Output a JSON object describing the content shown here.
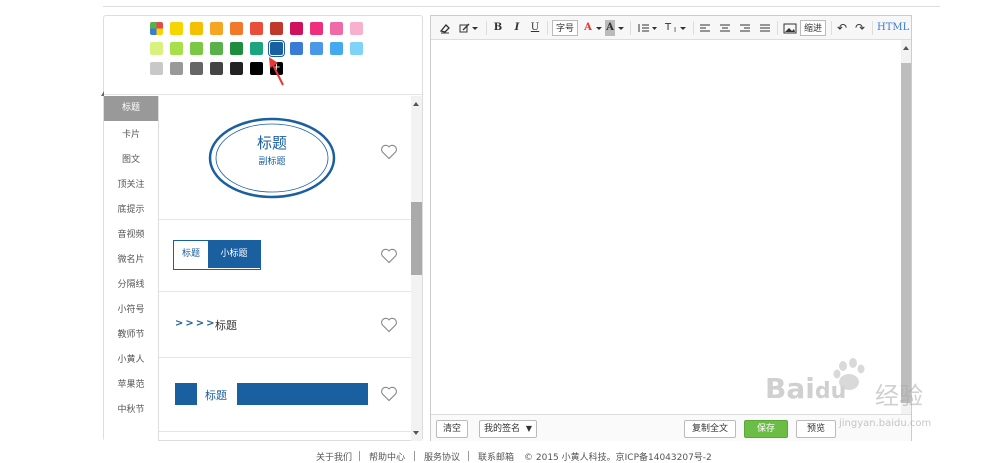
{
  "palette": {
    "row1": [
      "#e5484d",
      "#f7d600",
      "#f5c000",
      "#f5a623",
      "#f07a2a",
      "#e94e3a",
      "#c0392b",
      "#d0105a",
      "#ef2e7c",
      "#f06aa7",
      "#f7b1cf"
    ],
    "row2": [
      "#d9f27f",
      "#a8e04b",
      "#7ac843",
      "#59b14a",
      "#1e8e3e",
      "#1aa57e",
      "#1a5fa0",
      "#3a7bd5",
      "#4a98e8",
      "#44aaf0",
      "#7fd3f8"
    ],
    "row3": [
      "#c8c8c8",
      "#999999",
      "#666666",
      "#444444",
      "#222222",
      "#000000",
      "#000000"
    ],
    "add_label": "+"
  },
  "categories": [
    "标题",
    "卡片",
    "图文",
    "顶关注",
    "底提示",
    "音视频",
    "微名片",
    "分隔线",
    "小符号",
    "教师节",
    "小黄人",
    "苹果范",
    "中秋节"
  ],
  "templates": {
    "t1": {
      "title": "标题",
      "subtitle": "副标题"
    },
    "t2": {
      "left": "标题",
      "right": "小标题"
    },
    "t3": {
      "arrows": ">>>>",
      "title": "标题"
    },
    "t4": {
      "title": "标题"
    }
  },
  "toolbar": {
    "bold": "B",
    "italic": "I",
    "underline": "U",
    "fontsize": "字号",
    "fontcolor": "A",
    "bgcolor": "A",
    "heading": "T",
    "indent": "缩进",
    "html": "HTML",
    "undo": "↶",
    "redo": "↷"
  },
  "bottombar": {
    "clear": "清空",
    "signature": "我的签名",
    "copy_all": "复制全文",
    "save": "保存",
    "preview": "预览"
  },
  "footer": {
    "about": "关于我们",
    "help": "帮助中心",
    "terms": "服务协议",
    "email": "联系邮箱",
    "copyright": "© 2015 小黄人科技。京ICP备14043207号-2"
  },
  "watermark": {
    "brand": "Bai",
    "brand2": "du",
    "cn": "经验",
    "url": "jingyan.baidu.com"
  },
  "colors": {
    "accent": "#1a5fa0",
    "green": "#6bbd46"
  }
}
